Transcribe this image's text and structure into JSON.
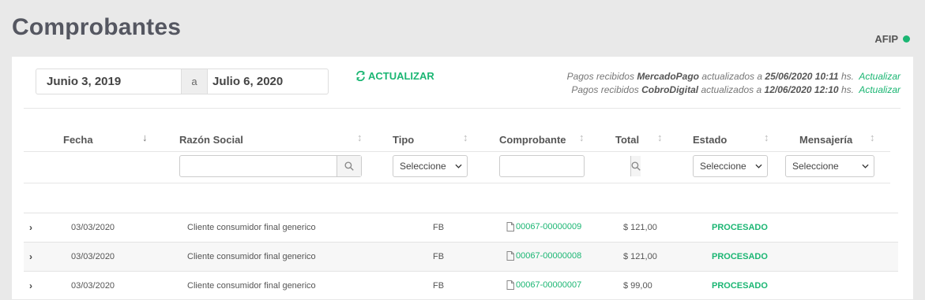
{
  "page": {
    "title": "Comprobantes",
    "afip_label": "AFIP"
  },
  "daterange": {
    "from": "Junio 3, 2019",
    "separator": "a",
    "to": "Julio 6, 2020"
  },
  "refresh_label": "ACTUALIZAR",
  "sync": [
    {
      "prefix": "Pagos recibidos",
      "source": "MercadoPago",
      "mid": "actualizados a",
      "datetime": "25/06/2020 10:11",
      "suffix": "hs.",
      "link": "Actualizar"
    },
    {
      "prefix": "Pagos recibidos",
      "source": "CobroDigital",
      "mid": "actualizados a",
      "datetime": "12/06/2020 12:10",
      "suffix": "hs.",
      "link": "Actualizar"
    }
  ],
  "columns": [
    "Fecha",
    "Razón Social",
    "Tipo",
    "Comprobante",
    "Total",
    "Estado",
    "Mensajería"
  ],
  "filters": {
    "tipo": "Seleccione",
    "estado": "Seleccione",
    "mensajeria": "Seleccione"
  },
  "rows": [
    {
      "fecha": "03/03/2020",
      "razon": "Cliente consumidor final generico",
      "tipo": "FB",
      "comprobante": "00067-00000009",
      "total": "$ 121,00",
      "estado": "PROCESADO"
    },
    {
      "fecha": "03/03/2020",
      "razon": "Cliente consumidor final generico",
      "tipo": "FB",
      "comprobante": "00067-00000008",
      "total": "$ 121,00",
      "estado": "PROCESADO"
    },
    {
      "fecha": "03/03/2020",
      "razon": "Cliente consumidor final generico",
      "tipo": "FB",
      "comprobante": "00067-00000007",
      "total": "$ 99,00",
      "estado": "PROCESADO"
    }
  ],
  "colors": {
    "accent": "#1bb673",
    "title": "#555761"
  }
}
